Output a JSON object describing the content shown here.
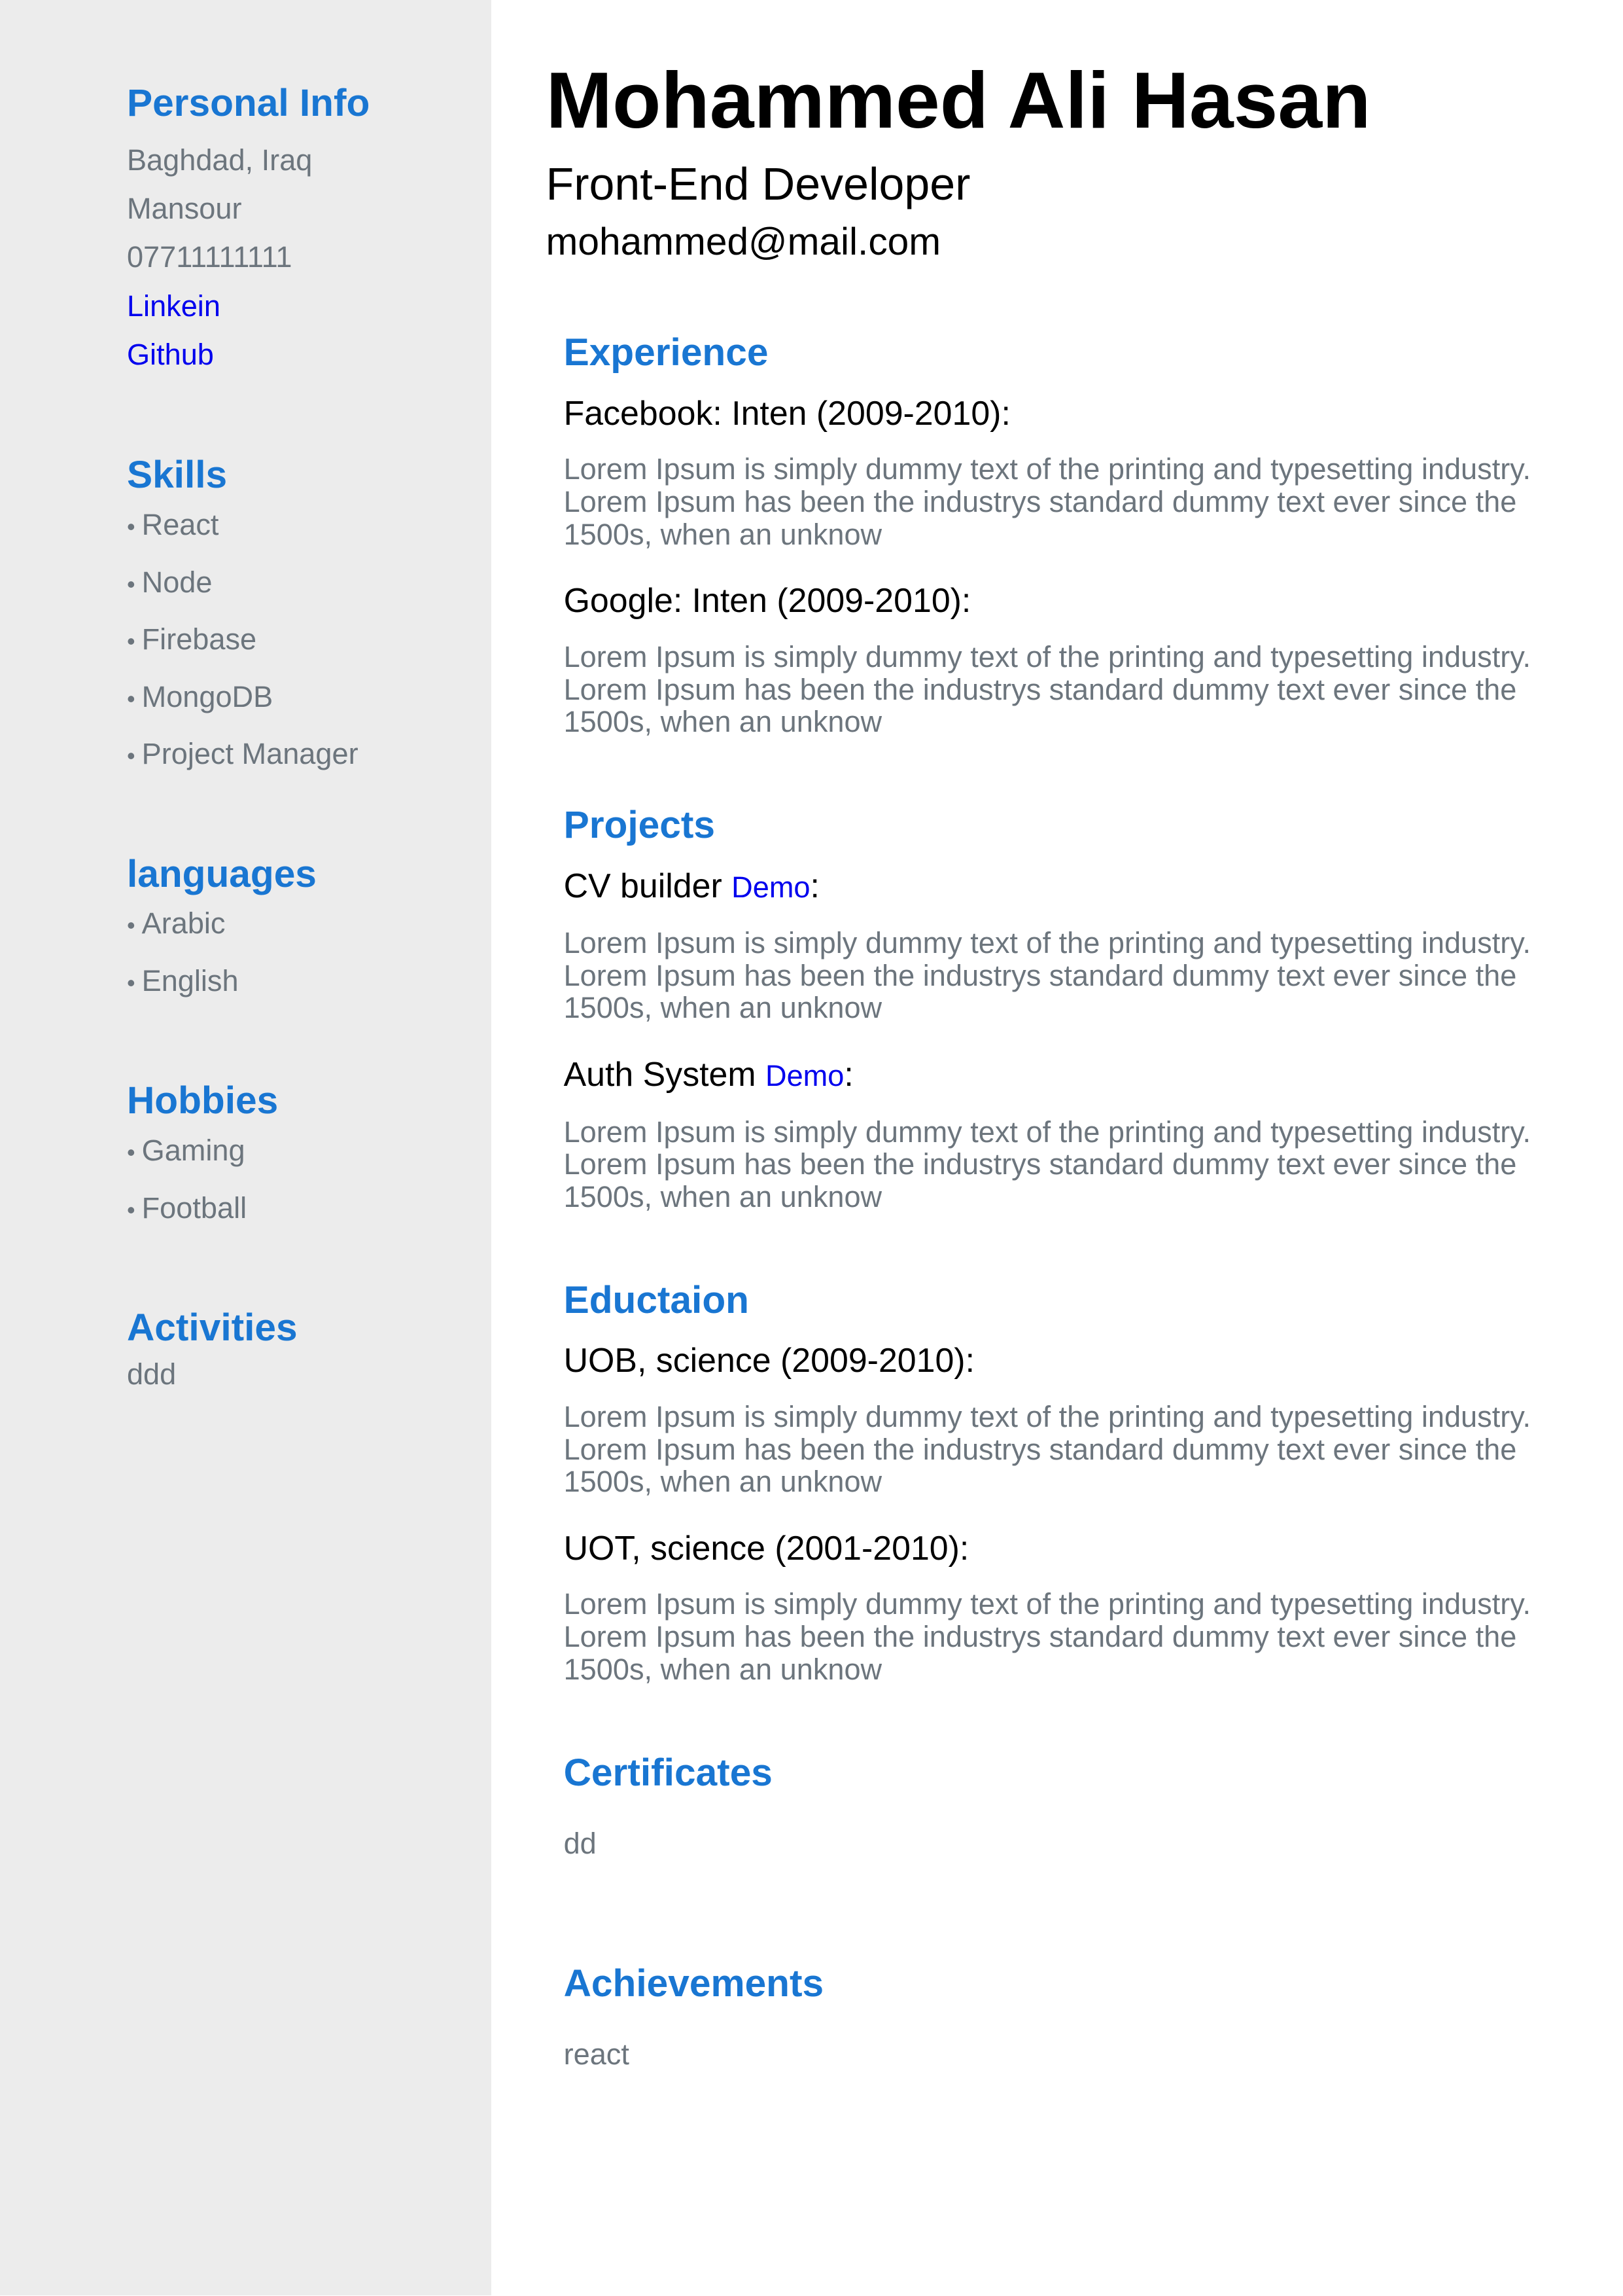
{
  "sidebar": {
    "personal_info": {
      "title": "Personal Info",
      "address": "Baghdad, Iraq",
      "area": "Mansour",
      "phone": "07711111111",
      "linkedin": "Linkein",
      "github": "Github"
    },
    "skills": {
      "title": "Skills",
      "items": [
        "React",
        "Node",
        "Firebase",
        "MongoDB",
        "Project Manager"
      ]
    },
    "languages": {
      "title": "languages",
      "items": [
        "Arabic",
        "English"
      ]
    },
    "hobbies": {
      "title": "Hobbies",
      "items": [
        "Gaming",
        "Football"
      ]
    },
    "activities": {
      "title": "Activities",
      "text": "ddd"
    }
  },
  "header": {
    "name": "Mohammed Ali Hasan",
    "role": "Front-End Developer",
    "email": "mohammed@mail.com"
  },
  "experience": {
    "title": "Experience",
    "items": [
      {
        "heading": "Facebook: Inten (2009-2010):",
        "desc": "Lorem Ipsum is simply dummy text of the printing and typesetting industry. Lorem Ipsum has been the industrys standard dummy text ever since the 1500s, when an unknow"
      },
      {
        "heading": "Google: Inten (2009-2010):",
        "desc": "Lorem Ipsum is simply dummy text of the printing and typesetting industry. Lorem Ipsum has been the industrys standard dummy text ever since the 1500s, when an unknow"
      }
    ]
  },
  "projects": {
    "title": "Projects",
    "items": [
      {
        "name": "CV builder",
        "link": "Demo",
        "suffix": ":",
        "desc": "Lorem Ipsum is simply dummy text of the printing and typesetting industry. Lorem Ipsum has been the industrys standard dummy text ever since the 1500s, when an unknow"
      },
      {
        "name": "Auth System",
        "link": "Demo",
        "suffix": ":",
        "desc": "Lorem Ipsum is simply dummy text of the printing and typesetting industry. Lorem Ipsum has been the industrys standard dummy text ever since the 1500s, when an unknow"
      }
    ]
  },
  "education": {
    "title": "Eductaion",
    "items": [
      {
        "heading": "UOB, science (2009-2010):",
        "desc": "Lorem Ipsum is simply dummy text of the printing and typesetting industry. Lorem Ipsum has been the industrys standard dummy text ever since the 1500s, when an unknow"
      },
      {
        "heading": "UOT, science (2001-2010):",
        "desc": "Lorem Ipsum is simply dummy text of the printing and typesetting industry. Lorem Ipsum has been the industrys standard dummy text ever since the 1500s, when an unknow"
      }
    ]
  },
  "certificates": {
    "title": "Certificates",
    "text": "dd"
  },
  "achievements": {
    "title": "Achievements",
    "text": "react"
  },
  "colors": {
    "accent": "#1976d2",
    "link": "#0000ee",
    "muted": "#6c757d",
    "sidebar_bg": "#ececec"
  }
}
